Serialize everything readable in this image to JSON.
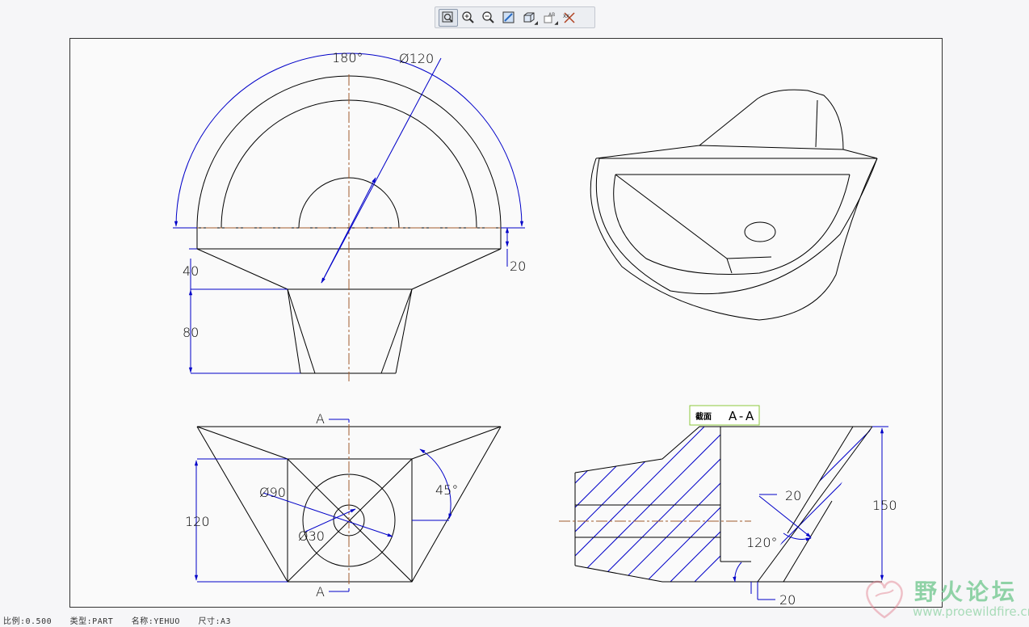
{
  "toolbar": {
    "buttons": [
      {
        "icon": "zoom-fit-icon"
      },
      {
        "icon": "zoom-in-icon"
      },
      {
        "icon": "zoom-out-icon"
      },
      {
        "icon": "repaint-icon"
      },
      {
        "icon": "display-style-icon"
      },
      {
        "icon": "annotation-display-icon"
      },
      {
        "icon": "datum-display-icon"
      }
    ]
  },
  "dimensions": {
    "top_angle": "180°",
    "top_diameter": "Ø120",
    "dim_40": "40",
    "dim_20_top": "20",
    "dim_80": "80",
    "section_marker_top": "A",
    "section_marker_bottom": "A",
    "dim_120": "120",
    "dim_d90": "Ø90",
    "dim_d30": "Ø30",
    "dim_45": "45°",
    "dim_150": "150",
    "dim_20_mid": "20",
    "dim_120deg": "120°",
    "dim_20_bottom": "20"
  },
  "section_label": {
    "prefix": "截面",
    "name": "A-A"
  },
  "status": {
    "scale": "比例:0.500",
    "type": "类型:PART",
    "name": "名称:YEHUO",
    "size": "尺寸:A3"
  },
  "watermark": {
    "title": "野火论坛",
    "url": "www.proewildfire.cn"
  },
  "colors": {
    "dimension": "#0000c8",
    "centerline": "#a05a2c",
    "geometry": "#000000",
    "section_box": "#8cc83c"
  }
}
